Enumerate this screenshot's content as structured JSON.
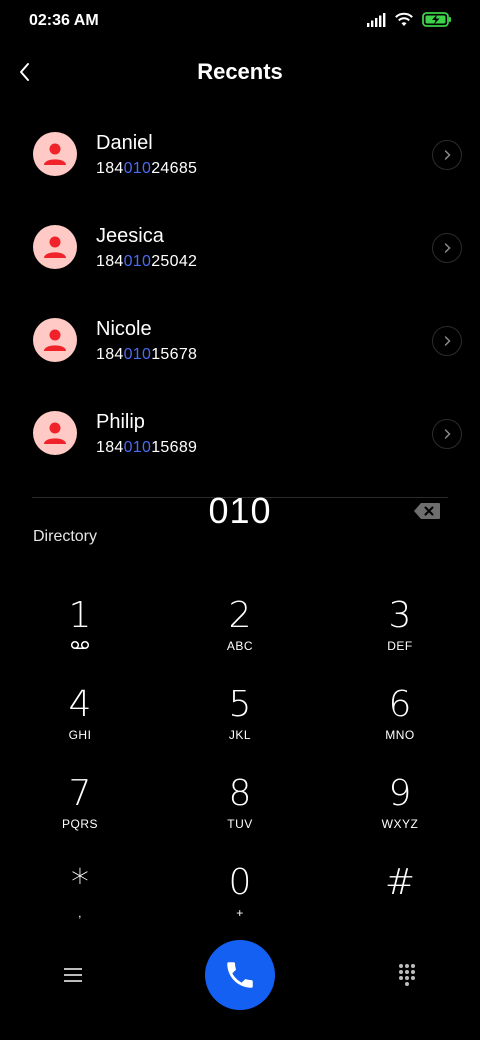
{
  "status_bar": {
    "time": "02:36 AM",
    "icons": [
      "signal-icon",
      "wifi-icon",
      "battery-charging-icon"
    ],
    "battery_color": "#3cd24a"
  },
  "header": {
    "title": "Recents",
    "back_icon": "chevron-left-icon"
  },
  "contacts": [
    {
      "name": "Daniel",
      "number_prefix": "184",
      "number_match": "010",
      "number_suffix": "24685"
    },
    {
      "name": "Jeesica",
      "number_prefix": "184",
      "number_match": "010",
      "number_suffix": "25042"
    },
    {
      "name": "Nicole",
      "number_prefix": "184",
      "number_match": "010",
      "number_suffix": "15678"
    },
    {
      "name": "Philip",
      "number_prefix": "184",
      "number_match": "010",
      "number_suffix": "15689"
    }
  ],
  "dialer": {
    "input": "010",
    "directory_label": "Directory"
  },
  "keypad": [
    {
      "digit": "1",
      "letters": ""
    },
    {
      "digit": "2",
      "letters": "ABC"
    },
    {
      "digit": "3",
      "letters": "DEF"
    },
    {
      "digit": "4",
      "letters": "GHI"
    },
    {
      "digit": "5",
      "letters": "JKL"
    },
    {
      "digit": "6",
      "letters": "MNO"
    },
    {
      "digit": "7",
      "letters": "PQRS"
    },
    {
      "digit": "8",
      "letters": "TUV"
    },
    {
      "digit": "9",
      "letters": "WXYZ"
    },
    {
      "digit": "*",
      "letters": ","
    },
    {
      "digit": "0",
      "letters": "+"
    },
    {
      "digit": "#",
      "letters": ""
    }
  ],
  "colors": {
    "accent": "#1460f2",
    "match_highlight": "#4a6cf0",
    "avatar_bg": "#ffc9c5",
    "avatar_fg": "#f0222a"
  }
}
